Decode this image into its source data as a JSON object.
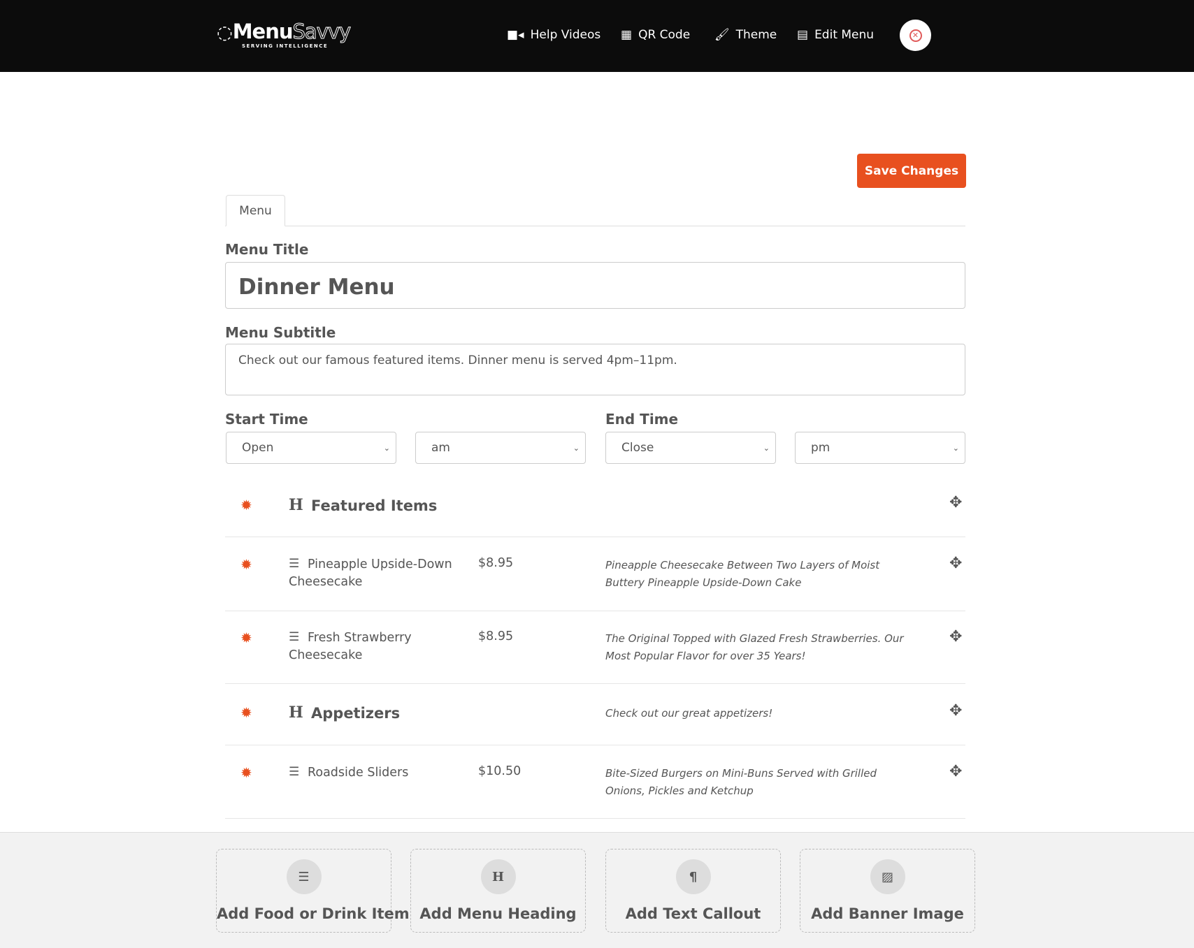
{
  "header": {
    "logo": {
      "main": "Menu",
      "accent": "Savvy",
      "tagline": "SERVING INTELLIGENCE"
    },
    "nav": [
      {
        "label": "Help Videos",
        "icon": "video-icon"
      },
      {
        "label": "QR Code",
        "icon": "qrcode-icon"
      },
      {
        "label": "Theme",
        "icon": "brush-icon"
      },
      {
        "label": "Edit Menu",
        "icon": "list-icon"
      }
    ],
    "avatar": "restaurant-logo"
  },
  "save_label": "Save Changes",
  "tab": "Menu",
  "form": {
    "title_label": "Menu Title",
    "title_value": "Dinner Menu",
    "subtitle_label": "Menu Subtitle",
    "subtitle_value": "Check out our famous featured items. Dinner menu is served 4pm–11pm.",
    "start_label": "Start Time",
    "start_value": "Open",
    "start_ampm": "am",
    "end_label": "End Time",
    "end_value": "Close",
    "end_ampm": "pm"
  },
  "rows": [
    {
      "type": "heading",
      "title": "Featured Items",
      "desc": ""
    },
    {
      "type": "item",
      "name": "Pineapple Upside-Down Cheesecake",
      "price": "$8.95",
      "desc": "Pineapple Cheesecake Between Two Layers of Moist Buttery Pineapple Upside-Down Cake"
    },
    {
      "type": "item",
      "name": "Fresh Strawberry Cheesecake",
      "price": "$8.95",
      "desc": "The Original Topped with Glazed Fresh Strawberries. Our Most Popular Flavor for over 35 Years!"
    },
    {
      "type": "heading",
      "title": "Appetizers",
      "desc": "Check out our great appetizers!"
    },
    {
      "type": "item",
      "name": "Roadside Sliders",
      "price": "$10.50",
      "desc": "Bite-Sized Burgers on Mini-Buns Served with Grilled Onions, Pickles and Ketchup"
    }
  ],
  "add_buttons": [
    {
      "label": "Add Food or Drink Item",
      "icon": "list-icon"
    },
    {
      "label": "Add Menu Heading",
      "icon": "heading-icon"
    },
    {
      "label": "Add Text Callout",
      "icon": "paragraph-icon"
    },
    {
      "label": "Add Banner Image",
      "icon": "image-icon"
    }
  ],
  "colors": {
    "accent": "#e8501f",
    "header_bg": "#0c0c0c"
  }
}
